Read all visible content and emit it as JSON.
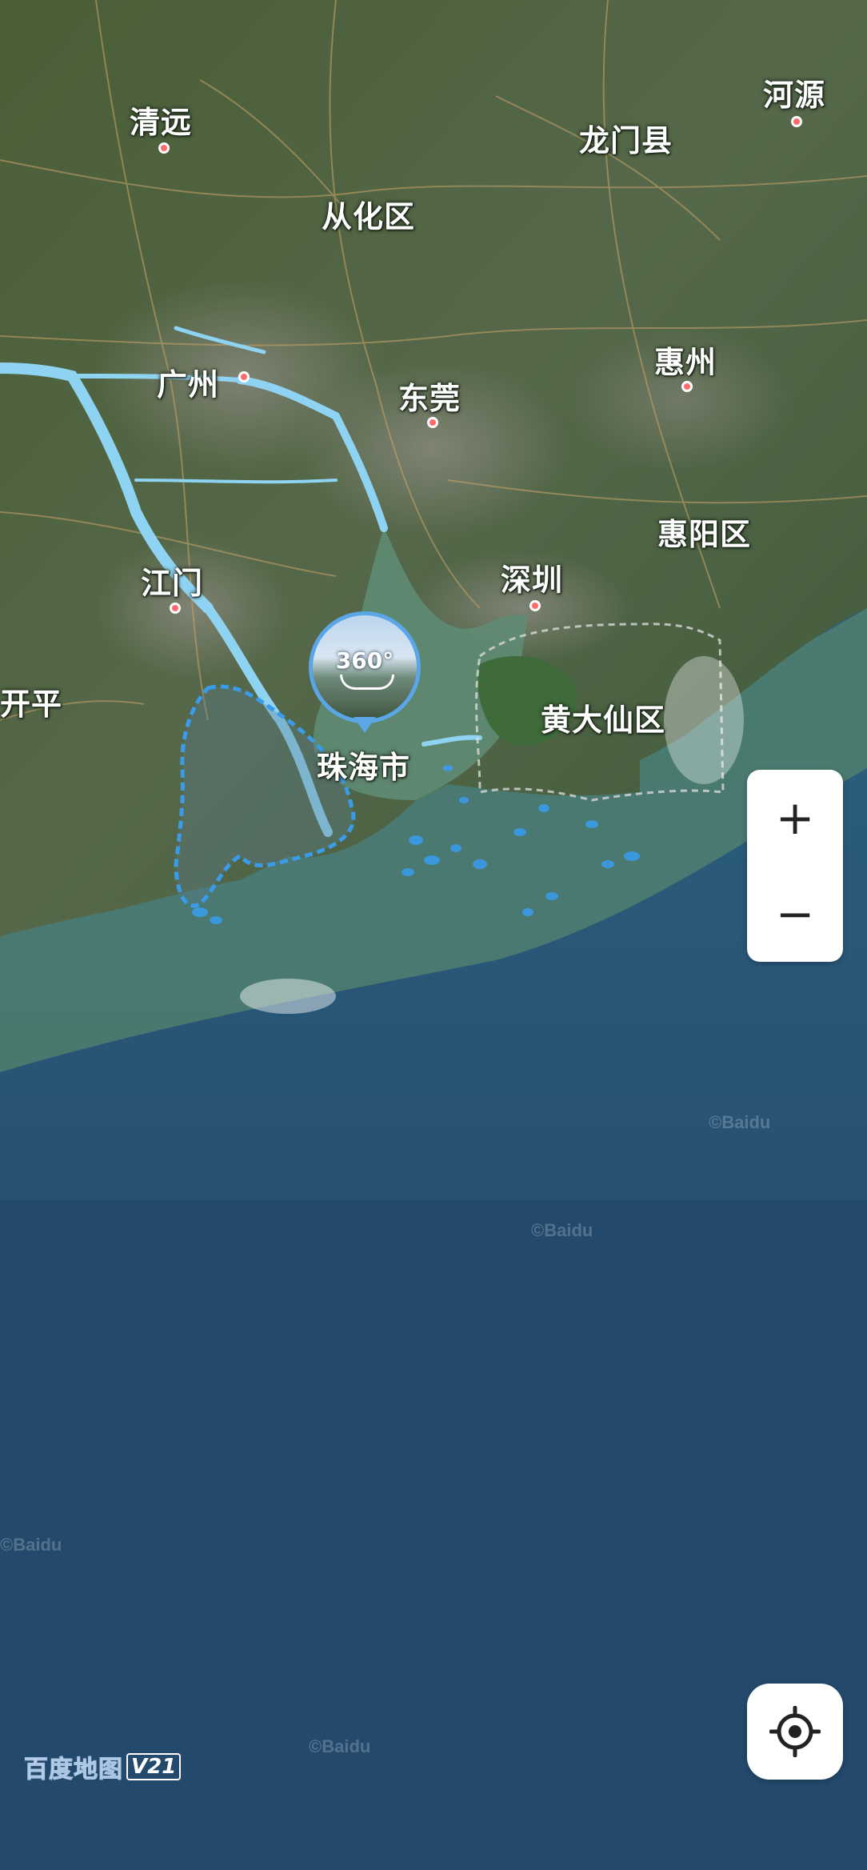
{
  "map": {
    "labels": [
      {
        "id": "qingyuan",
        "text": "清远",
        "has_dot": true
      },
      {
        "id": "heyuan",
        "text": "河源",
        "has_dot": true
      },
      {
        "id": "longmen",
        "text": "龙门县",
        "has_dot": false
      },
      {
        "id": "conghua",
        "text": "从化区",
        "has_dot": false
      },
      {
        "id": "guangzhou",
        "text": "广州",
        "has_dot": true
      },
      {
        "id": "dongguan",
        "text": "东莞",
        "has_dot": true
      },
      {
        "id": "huizhou",
        "text": "惠州",
        "has_dot": true
      },
      {
        "id": "huiyang",
        "text": "惠阳区",
        "has_dot": false
      },
      {
        "id": "jiangmen",
        "text": "江门",
        "has_dot": true
      },
      {
        "id": "shenzhen",
        "text": "深圳",
        "has_dot": true
      },
      {
        "id": "kaiping",
        "text": "开平",
        "has_dot": false
      },
      {
        "id": "huangdaxian",
        "text": "黄大仙区",
        "has_dot": false
      },
      {
        "id": "zhuhai",
        "text": "珠海市",
        "has_dot": false
      }
    ],
    "selected_city": "珠海市",
    "watermark": "©Baidu",
    "colors": {
      "ocean": "#23486b",
      "land": "#46603a",
      "river": "#8fd3f2",
      "boundary": "#3a9be8",
      "city_dot": "#ff6a6a"
    }
  },
  "panorama": {
    "label": "360°",
    "icon": "panorama-360-icon"
  },
  "controls": {
    "zoom_in_label": "+",
    "zoom_out_label": "−",
    "locate_icon": "locate-crosshair-icon"
  },
  "logo": {
    "text": "百度地图",
    "version": "V21"
  }
}
